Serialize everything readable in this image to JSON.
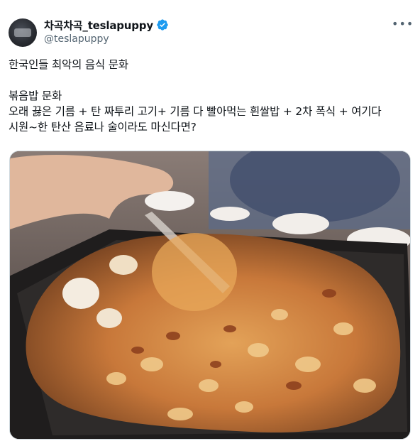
{
  "author": {
    "display_name": "차곡차곡_teslapuppy",
    "handle": "@teslapuppy",
    "verified_color": "#1d9bf0"
  },
  "menu": {
    "more_icon": "more-dots-icon"
  },
  "tweet": {
    "lines": [
      "한국인들 최악의 음식 문화",
      "",
      "볶음밥 문화",
      "오래 끓은 기름 + 탄 짜투리 고기+ 기름 다 빨아먹는 흰쌀밥 + 2차 폭식 + 여기다",
      "시원~한 탄산 음료나 술이라도 마신다면?"
    ]
  },
  "media": {
    "type": "photo"
  }
}
